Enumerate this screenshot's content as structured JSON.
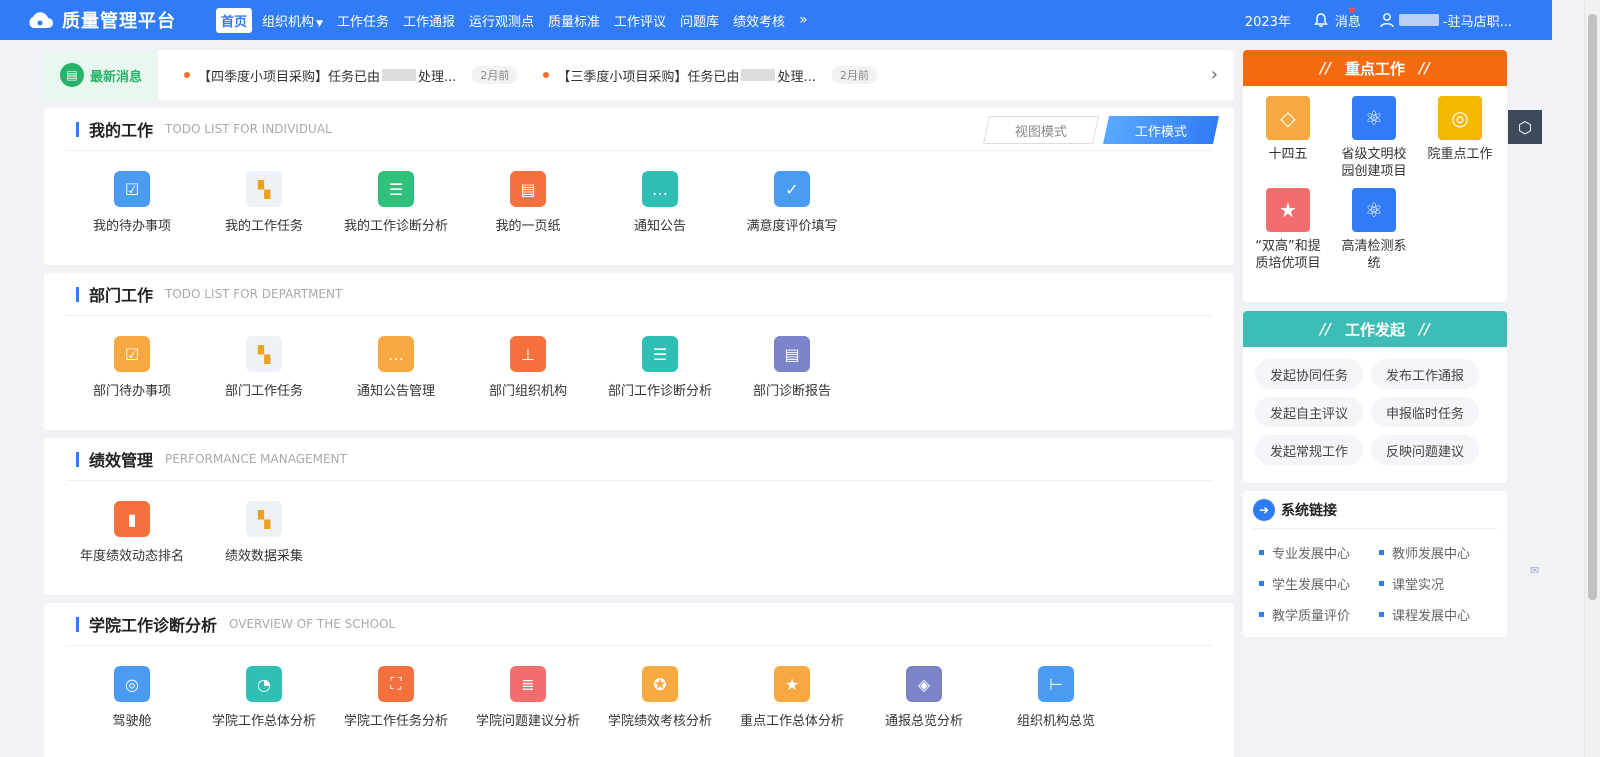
{
  "app": {
    "title": "质量管理平台"
  },
  "nav": {
    "items": [
      "首页",
      "组织机构",
      "工作任务",
      "工作通报",
      "运行观测点",
      "质量标准",
      "工作评议",
      "问题库",
      "绩效考核"
    ],
    "more": "»"
  },
  "top_right": {
    "year": "2023年",
    "message": "消息",
    "user_suffix": "-驻马店职..."
  },
  "news": {
    "label": "最新消息",
    "items": [
      {
        "pre": "【四季度小项目采购】任务已由",
        "post": "处理...",
        "ago": "2月前"
      },
      {
        "pre": "【三季度小项目采购】任务已由",
        "post": "处理...",
        "ago": "2月前"
      }
    ]
  },
  "mode": {
    "view": "视图模式",
    "work": "工作模式"
  },
  "sections": {
    "mine": {
      "title": "我的工作",
      "sub": "TODO LIST FOR INDIVIDUAL",
      "items": [
        "我的待办事项",
        "我的工作任务",
        "我的工作诊断分析",
        "我的一页纸",
        "通知公告",
        "满意度评价填写"
      ]
    },
    "dept": {
      "title": "部门工作",
      "sub": "TODO LIST FOR DEPARTMENT",
      "items": [
        "部门待办事项",
        "部门工作任务",
        "通知公告管理",
        "部门组织机构",
        "部门工作诊断分析",
        "部门诊断报告"
      ]
    },
    "perf": {
      "title": "绩效管理",
      "sub": "PERFORMANCE MANAGEMENT",
      "items": [
        "年度绩效动态排名",
        "绩效数据采集"
      ]
    },
    "school": {
      "title": "学院工作诊断分析",
      "sub": "OVERVIEW OF THE SCHOOL",
      "items": [
        "驾驶舱",
        "学院工作总体分析",
        "学院工作任务分析",
        "学院问题建议分析",
        "学院绩效考核分析",
        "重点工作总体分析",
        "通报总览分析",
        "组织机构总览"
      ]
    }
  },
  "key_work": {
    "title": "重点工作",
    "items": [
      "十四五",
      "省级文明校园创建项目",
      "院重点工作",
      "“双高”和提质培优项目",
      "高清检测系统"
    ]
  },
  "launch": {
    "title": "工作发起",
    "items": [
      "发起协同任务",
      "发布工作通报",
      "发起自主评议",
      "申报临时任务",
      "发起常规工作",
      "反映问题建议"
    ]
  },
  "links": {
    "title": "系统链接",
    "items": [
      "专业发展中心",
      "教师发展中心",
      "学生发展中心",
      "课堂实况",
      "教学质量评价",
      "课程发展中心"
    ]
  },
  "colors": {
    "brand": "#2f7cf6",
    "key_header": "#f5690f",
    "launch_header": "#3dbdb5"
  }
}
